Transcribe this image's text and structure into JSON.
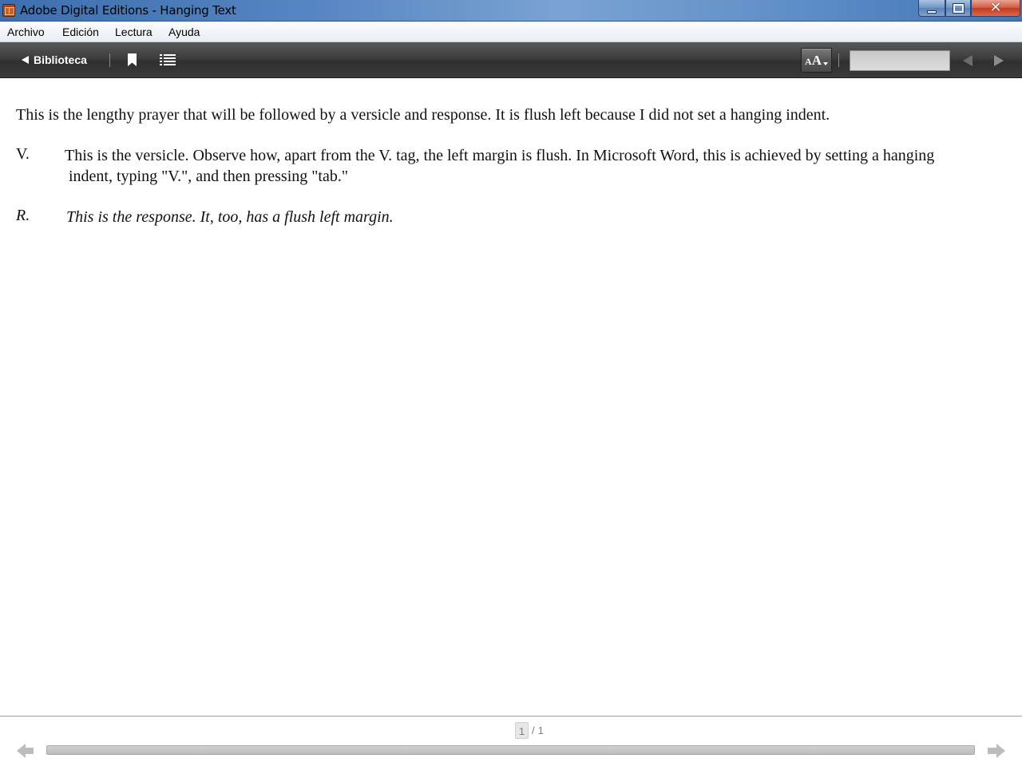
{
  "window": {
    "title": "Adobe Digital Editions - Hanging Text",
    "app_icon": "adobe-digital-editions-icon",
    "close_glyph": "✕"
  },
  "menu": {
    "items": [
      {
        "label": "Archivo"
      },
      {
        "label": "Edición"
      },
      {
        "label": "Lectura"
      },
      {
        "label": "Ayuda"
      }
    ]
  },
  "toolbar": {
    "library_label": "Biblioteca",
    "font_button_label": "AA",
    "icons": [
      "back-arrow-icon",
      "bookmark-icon",
      "table-of-contents-icon",
      "font-size-icon",
      "previous-icon",
      "next-icon"
    ],
    "search": {
      "value": "",
      "placeholder": ""
    }
  },
  "document": {
    "paragraph1": "This is the lengthy prayer that will be followed by a versicle and response. It is flush left because I did not set a hanging indent.",
    "versicle": {
      "label": "V.",
      "line1": "This is the versicle. Observe how, apart from the V. tag, the left margin is flush. In Microsoft Word, this is achieved by setting a hanging",
      "line2": "indent, typing \"V.\", and then pressing \"tab.\""
    },
    "response": {
      "label": "R.",
      "text": "This is the response. It, too, has a flush left margin."
    }
  },
  "footer": {
    "current_page": "1",
    "separator": "/",
    "total_pages": "1",
    "progress_fraction": 1.0
  },
  "colors": {
    "titlebar": "#5585c2",
    "toolbar": "#3d3d3d",
    "close_button": "#c23a1e"
  }
}
